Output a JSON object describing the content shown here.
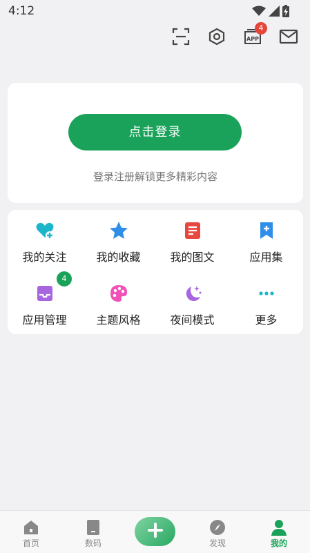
{
  "status_bar": {
    "time": "4:12"
  },
  "header": {
    "icons": [
      "scan-icon",
      "settings-icon",
      "app-icon",
      "mail-icon"
    ],
    "app_badge": "4"
  },
  "login": {
    "button_label": "点击登录",
    "hint": "登录注册解锁更多精彩内容"
  },
  "grid": {
    "items": [
      {
        "label": "我的关注",
        "icon": "heart-plus-icon",
        "color": "#1bb6c9"
      },
      {
        "label": "我的收藏",
        "icon": "star-icon",
        "color": "#2f8fe8"
      },
      {
        "label": "我的图文",
        "icon": "article-icon",
        "color": "#e8473f"
      },
      {
        "label": "应用集",
        "icon": "bookmark-plus-icon",
        "color": "#2f8fe8"
      },
      {
        "label": "应用管理",
        "icon": "inbox-icon",
        "color": "#a865e0",
        "badge": "4"
      },
      {
        "label": "主题风格",
        "icon": "palette-icon",
        "color": "#f052b8"
      },
      {
        "label": "夜间模式",
        "icon": "moon-stars-icon",
        "color": "#a865e0"
      },
      {
        "label": "更多",
        "icon": "more-dots-icon",
        "color": "#1bb6c9"
      }
    ]
  },
  "tabs": [
    {
      "label": "首页",
      "icon": "home-icon"
    },
    {
      "label": "数码",
      "icon": "phone-icon"
    },
    {
      "label": "发现",
      "icon": "compass-icon"
    },
    {
      "label": "我的",
      "icon": "person-icon",
      "active": true
    }
  ],
  "colors": {
    "accent": "#1aa25a",
    "badge_red": "#e5463a",
    "background": "#f1f1f3"
  }
}
